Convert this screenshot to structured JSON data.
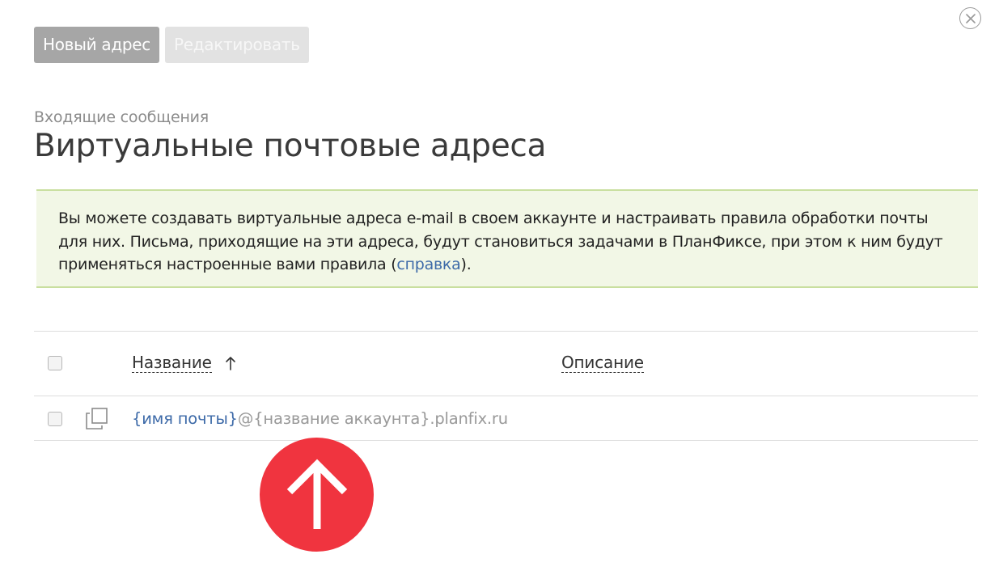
{
  "toolbar": {
    "new_label": "Новый адрес",
    "edit_label": "Редактировать"
  },
  "breadcrumb": "Входящие сообщения",
  "title": "Виртуальные почтовые адреса",
  "info": {
    "text_before_link": "Вы можете создавать виртуальные адреса e-mail в своем аккаунте и настраивать правила обработки почты для них. Письма, приходящие на эти адреса, будут становиться задачами в ПланФиксе, при этом к ним будут применяться настроенные вами правила (",
    "link_text": "справка",
    "text_after_link": ")."
  },
  "table": {
    "columns": {
      "name": "Название",
      "description": "Описание"
    },
    "sort": "ascending",
    "rows": [
      {
        "name_part": "{имя почты}",
        "domain_part": "@{название аккаунта}.planfix.ru",
        "description": ""
      }
    ]
  },
  "icons": {
    "close": "close-icon",
    "sort": "arrow-up-icon",
    "copy": "copy-icon",
    "scroll_up": "arrow-up-icon"
  },
  "colors": {
    "accent_link": "#3d6aa8",
    "info_bg": "#f2f7e6",
    "info_border": "#c9df9f",
    "scroll_up_bg": "#f0343f"
  }
}
